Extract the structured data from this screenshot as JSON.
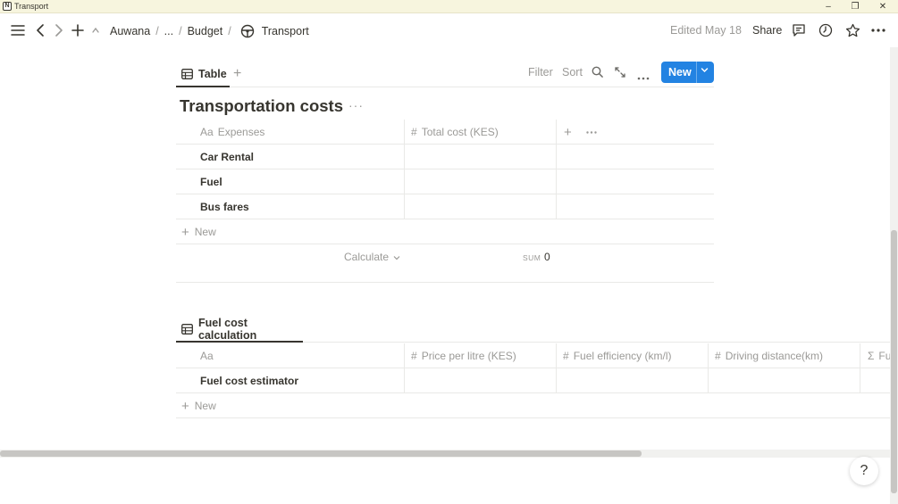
{
  "window": {
    "app_icon": "N",
    "title": "Transport",
    "minimize": "–",
    "maximize": "❐",
    "close": "✕"
  },
  "topbar": {
    "breadcrumb": [
      "Auwana",
      "...",
      "Budget",
      "Transport"
    ],
    "separator": "/",
    "edited": "Edited May 18",
    "share": "Share"
  },
  "db1": {
    "tab_label": "Table",
    "actions": {
      "filter": "Filter",
      "sort": "Sort"
    },
    "new_button": "New",
    "title": "Transportation costs",
    "more": "···",
    "columns": {
      "name_prefix": "Aa",
      "name": "Expenses",
      "cost_prefix": "#",
      "cost": "Total cost (KES)"
    },
    "rows": [
      "Car Rental",
      "Fuel",
      "Bus fares"
    ],
    "new_row": "New",
    "calculate": "Calculate",
    "sum_label": "SUM",
    "sum_value": "0"
  },
  "db2": {
    "tab_label": "Fuel cost calculation",
    "columns": {
      "name_prefix": "Aa",
      "price_prefix": "#",
      "price": "Price per litre (KES)",
      "efficiency_prefix": "#",
      "efficiency": "Fuel efficiency (km/l)",
      "distance_prefix": "#",
      "distance": "Driving distance(km)",
      "formula_prefix": "Σ",
      "formula": "Fu"
    },
    "rows": [
      "Fuel cost estimator"
    ],
    "new_row": "New"
  },
  "help": "?",
  "colors": {
    "accent": "#2383e2",
    "titlebar": "#f7f5de",
    "text": "#37352f",
    "muted": "#9b9a97"
  }
}
